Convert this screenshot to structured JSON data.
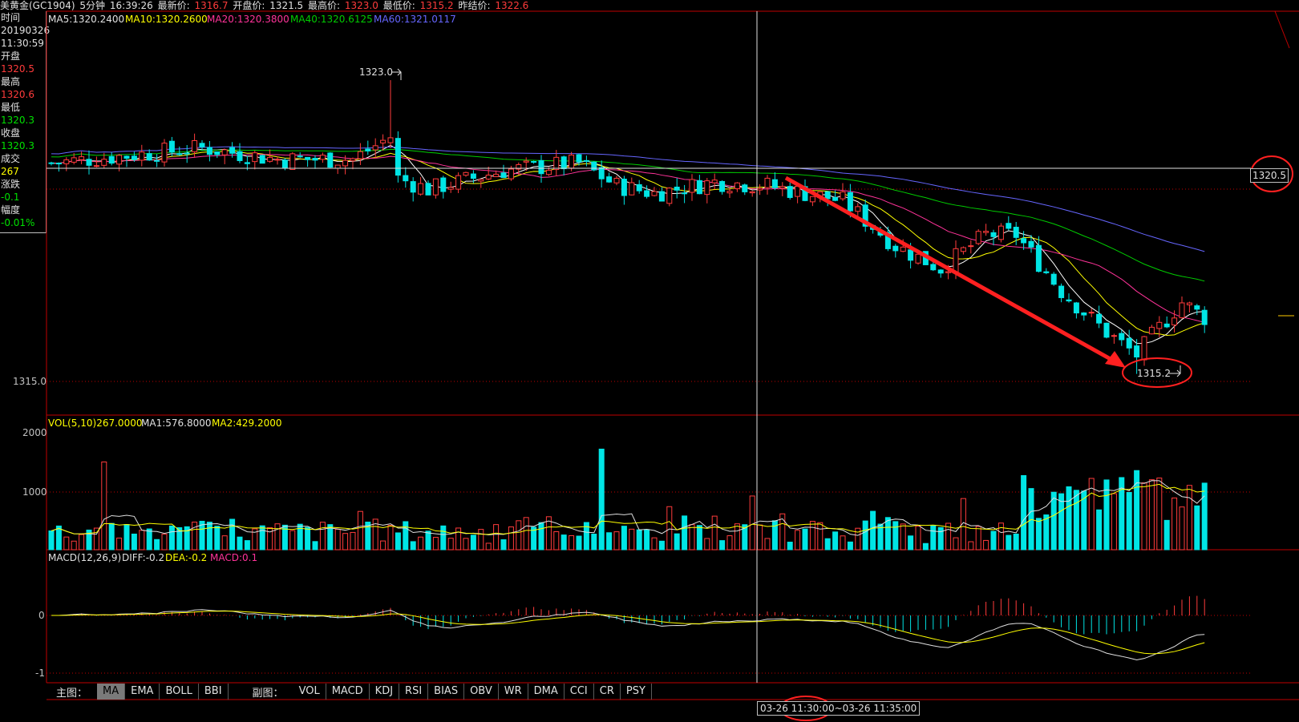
{
  "header": {
    "symbol": "美黄金(GC1904)",
    "period": "5分钟",
    "time": "16:39:26",
    "latest_label": "最新价:",
    "latest": "1316.7",
    "open_label": "开盘价:",
    "open": "1321.5",
    "high_label": "最高价:",
    "high": "1323.0",
    "low_label": "最低价:",
    "low": "1315.2",
    "prev_label": "昨结价:",
    "prev": "1322.6"
  },
  "info_panel": {
    "time_label": "时间",
    "date": "20190326",
    "clock": "11:30:59",
    "open_label": "开盘",
    "open": "1320.5",
    "high_label": "最高",
    "high": "1320.6",
    "low_label": "最低",
    "low": "1320.3",
    "close_label": "收盘",
    "close": "1320.3",
    "volume_label": "成交",
    "volume": "267",
    "change_label": "涨跌",
    "change": "-0.1",
    "pct_label": "幅度",
    "pct": "-0.01%"
  },
  "ma_legend": {
    "ma5": "MA5:1320.2400",
    "ma10": "MA10:1320.2600",
    "ma20": "MA20:1320.3800",
    "ma40": "MA40:1320.6125",
    "ma60": "MA60:1321.0117"
  },
  "vol_legend": {
    "vol": "VOL(5,10)267.0000",
    "ma1": "MA1:576.8000",
    "ma2": "MA2:429.2000"
  },
  "macd_legend": {
    "title": "MACD(12,26,9)",
    "diff": "DIFF:-0.2",
    "dea": "DEA:-0.2",
    "macd": "MACD:0.1"
  },
  "price_axis": {
    "label_1315": "1315.0",
    "crosshair_price": "1320.5"
  },
  "annotations": {
    "high_mark": "1323.0",
    "low_mark": "1315.2"
  },
  "vol_axis": [
    "2000",
    "1000"
  ],
  "macd_axis": [
    "0",
    "-1"
  ],
  "tabs": {
    "main_label": "主图：",
    "main": [
      "MA",
      "EMA",
      "BOLL",
      "BBI"
    ],
    "sub_label": "副图：",
    "sub": [
      "VOL",
      "MACD",
      "KDJ",
      "RSI",
      "BIAS",
      "OBV",
      "WR",
      "DMA",
      "CCI",
      "CR",
      "PSY"
    ]
  },
  "time_range": "03-26  11:30:00~03-26 11:35:00",
  "colors": {
    "up": "#ff3b3b",
    "down": "#00e5e5",
    "ma5": "#ffffff",
    "ma10": "#ffff00",
    "ma20": "#ff3399",
    "ma40": "#00cc00",
    "ma60": "#6666ff",
    "annotation": "#ff2020"
  },
  "chart_data": {
    "type": "candlestick",
    "period": "5分钟",
    "price_range": [
      1315.0,
      1323.0
    ],
    "labeled_high": 1323.0,
    "labeled_low": 1315.2,
    "crosshair_price": 1320.5,
    "volume_range": [
      0,
      2000
    ],
    "macd_range": [
      -1,
      0.3
    ]
  }
}
